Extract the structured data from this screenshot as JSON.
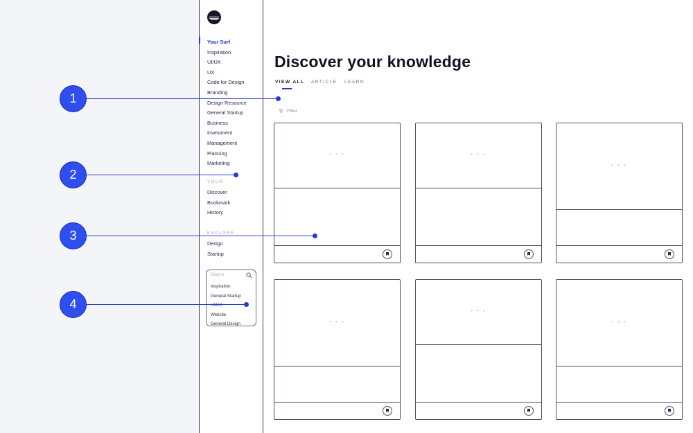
{
  "sidebar": {
    "nav_items": [
      "Your Surf",
      "Inspiration",
      "UI/UX",
      "UX",
      "Code for Design",
      "Branding",
      "Design Resource",
      "General Startup",
      "Business",
      "Investment",
      "Management",
      "Planning",
      "Marketing"
    ],
    "your_label": "YOUR",
    "your_items": [
      "Discover",
      "Bookmark",
      "History"
    ],
    "explore_label": "EXPLORE",
    "explore_items": [
      "Design",
      "Startup"
    ],
    "search": {
      "placeholder": "Search",
      "items": [
        "Inspiration",
        "General Startup",
        "UI/UX",
        "Website",
        "General Design"
      ],
      "highlighted": "UI/UX"
    }
  },
  "main": {
    "title": "Discover your knowledge",
    "tabs": [
      "VIEW ALL",
      "ARTICLE",
      "LEARN"
    ],
    "active_tab": "VIEW ALL",
    "filter_label": "Filter",
    "card_placeholder": "• • •"
  },
  "callouts": [
    "1",
    "2",
    "3",
    "4"
  ],
  "colors": {
    "accent": "#2f4ef0",
    "left_background": "#f3f5f8",
    "text": "#111323"
  },
  "icons": {
    "logo": "wave-logo-icon",
    "search": "search-icon",
    "filter": "filter-icon",
    "bookmark": "bookmark-icon"
  }
}
